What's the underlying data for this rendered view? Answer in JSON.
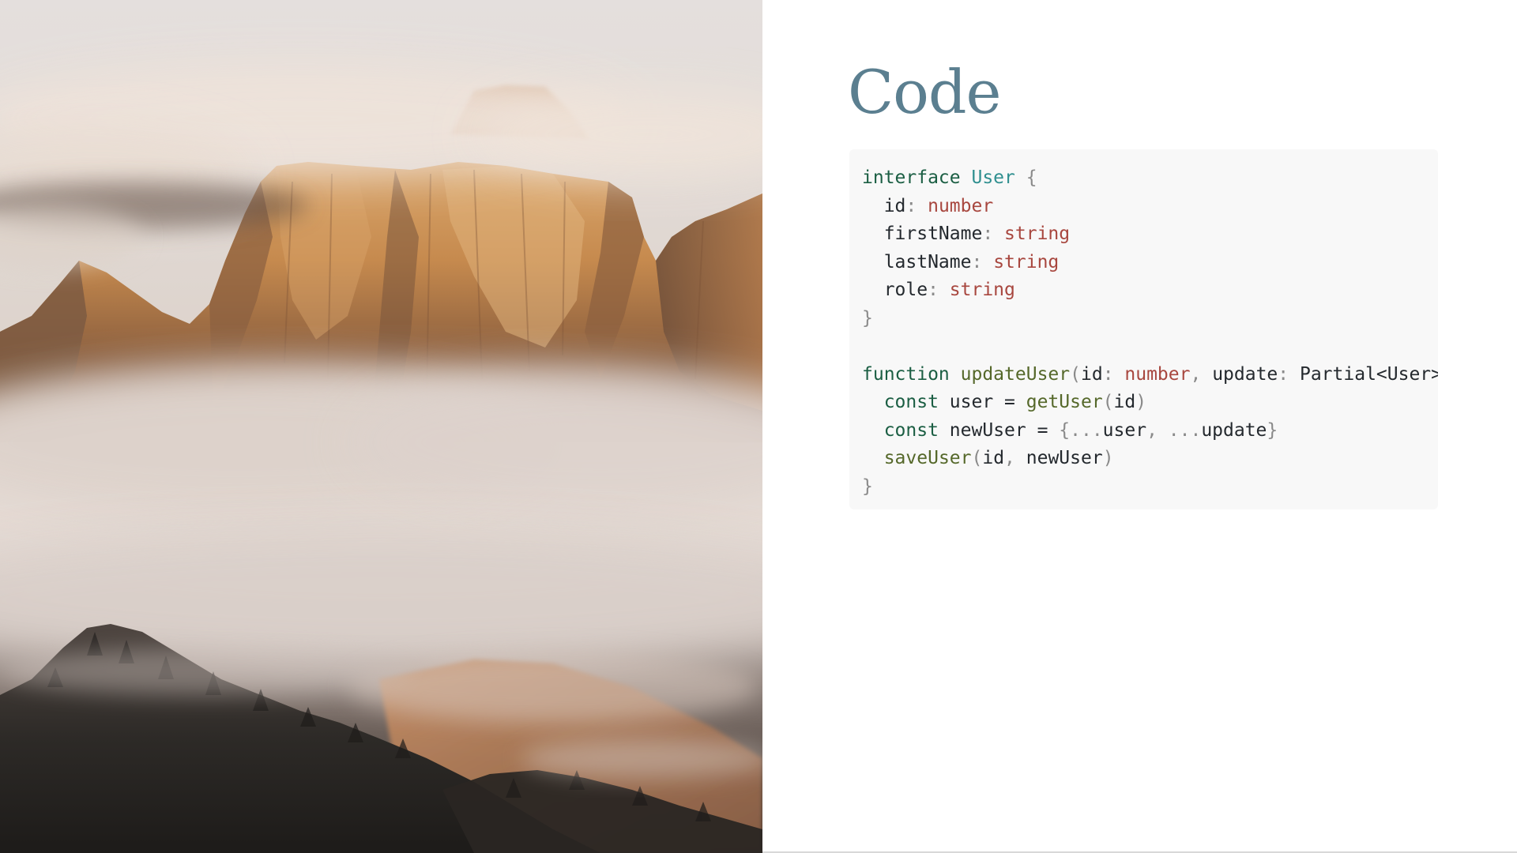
{
  "slide": {
    "title": "Code",
    "photo_alt": "Mountain peaks rising above clouds and fog"
  },
  "code": {
    "language": "typescript",
    "lines": [
      [
        {
          "t": "interface",
          "c": "kw"
        },
        {
          "t": " ",
          "c": "id"
        },
        {
          "t": "User",
          "c": "type"
        },
        {
          "t": " {",
          "c": "punc"
        }
      ],
      [
        {
          "t": "  id",
          "c": "id"
        },
        {
          "t": ": ",
          "c": "punc"
        },
        {
          "t": "number",
          "c": "prim"
        }
      ],
      [
        {
          "t": "  firstName",
          "c": "id"
        },
        {
          "t": ": ",
          "c": "punc"
        },
        {
          "t": "string",
          "c": "prim"
        }
      ],
      [
        {
          "t": "  lastName",
          "c": "id"
        },
        {
          "t": ": ",
          "c": "punc"
        },
        {
          "t": "string",
          "c": "prim"
        }
      ],
      [
        {
          "t": "  role",
          "c": "id"
        },
        {
          "t": ": ",
          "c": "punc"
        },
        {
          "t": "string",
          "c": "prim"
        }
      ],
      [
        {
          "t": "}",
          "c": "punc"
        }
      ],
      [],
      [
        {
          "t": "function",
          "c": "kw"
        },
        {
          "t": " ",
          "c": "id"
        },
        {
          "t": "updateUser",
          "c": "fn"
        },
        {
          "t": "(",
          "c": "punc"
        },
        {
          "t": "id",
          "c": "id"
        },
        {
          "t": ": ",
          "c": "punc"
        },
        {
          "t": "number",
          "c": "prim"
        },
        {
          "t": ", ",
          "c": "punc"
        },
        {
          "t": "update",
          "c": "id"
        },
        {
          "t": ": ",
          "c": "punc"
        },
        {
          "t": "Partial<User>) {",
          "c": "id"
        }
      ],
      [
        {
          "t": "  ",
          "c": "id"
        },
        {
          "t": "const",
          "c": "kw"
        },
        {
          "t": " user = ",
          "c": "id"
        },
        {
          "t": "getUser",
          "c": "fn"
        },
        {
          "t": "(",
          "c": "punc"
        },
        {
          "t": "id",
          "c": "id"
        },
        {
          "t": ")",
          "c": "punc"
        }
      ],
      [
        {
          "t": "  ",
          "c": "id"
        },
        {
          "t": "const",
          "c": "kw"
        },
        {
          "t": " newUser = ",
          "c": "id"
        },
        {
          "t": "{...",
          "c": "punc"
        },
        {
          "t": "user",
          "c": "id"
        },
        {
          "t": ", ...",
          "c": "punc"
        },
        {
          "t": "update",
          "c": "id"
        },
        {
          "t": "}",
          "c": "punc"
        }
      ],
      [
        {
          "t": "  ",
          "c": "id"
        },
        {
          "t": "saveUser",
          "c": "fn"
        },
        {
          "t": "(",
          "c": "punc"
        },
        {
          "t": "id",
          "c": "id"
        },
        {
          "t": ", ",
          "c": "punc"
        },
        {
          "t": "newUser",
          "c": "id"
        },
        {
          "t": ")",
          "c": "punc"
        }
      ],
      [
        {
          "t": "}",
          "c": "punc"
        }
      ]
    ]
  },
  "colors": {
    "title": "#5b7f90",
    "code_background": "#f8f8f8",
    "keyword": "#1b5e43",
    "type": "#2f8f8f",
    "primitive": "#a8473f",
    "function": "#55682a",
    "punctuation": "#8a8a8a",
    "identifier": "#24292e"
  }
}
